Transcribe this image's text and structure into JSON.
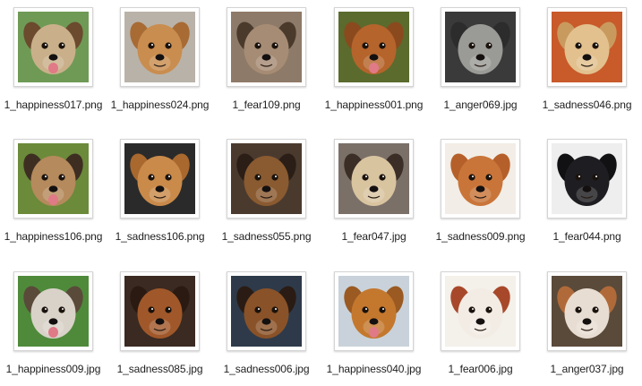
{
  "files": [
    {
      "name": "1_happiness017.png",
      "bg": "#6f9a55",
      "fur": "#c9b08a",
      "ear": "#6b4a2e",
      "tongue": true
    },
    {
      "name": "1_happiness024.png",
      "bg": "#b9b2a8",
      "fur": "#c98d4f",
      "ear": "#a86b34",
      "tongue": false
    },
    {
      "name": "1_fear109.png",
      "bg": "#8e7a68",
      "fur": "#a68c74",
      "ear": "#4a3a2c",
      "tongue": false
    },
    {
      "name": "1_happiness001.png",
      "bg": "#5a6b2d",
      "fur": "#b5642c",
      "ear": "#8a4a1e",
      "tongue": true
    },
    {
      "name": "1_anger069.jpg",
      "bg": "#3a3a3a",
      "fur": "#9a9a96",
      "ear": "#2c2c2c",
      "tongue": false
    },
    {
      "name": "1_sadness046.png",
      "bg": "#c95a2a",
      "fur": "#e2c18e",
      "ear": "#c99a5e",
      "tongue": false
    },
    {
      "name": "1_happiness106.png",
      "bg": "#6b8a3a",
      "fur": "#b58a5c",
      "ear": "#3e2e22",
      "tongue": true
    },
    {
      "name": "1_sadness106.png",
      "bg": "#2a2a2a",
      "fur": "#c98a4a",
      "ear": "#a8682e",
      "tongue": false
    },
    {
      "name": "1_sadness055.png",
      "bg": "#4a3a2e",
      "fur": "#8a5a30",
      "ear": "#2a1e16",
      "tongue": false
    },
    {
      "name": "1_fear047.jpg",
      "bg": "#7a7068",
      "fur": "#d9c4a0",
      "ear": "#3a2e26",
      "tongue": false
    },
    {
      "name": "1_sadness009.png",
      "bg": "#f2ede6",
      "fur": "#c9753a",
      "ear": "#b5602a",
      "tongue": false
    },
    {
      "name": "1_fear044.png",
      "bg": "#eeeeee",
      "fur": "#1e1e22",
      "ear": "#111114",
      "tongue": false
    },
    {
      "name": "1_happiness009.jpg",
      "bg": "#4f8a3a",
      "fur": "#d8d2c8",
      "ear": "#5a4a3a",
      "tongue": true
    },
    {
      "name": "1_sadness085.jpg",
      "bg": "#3a2a22",
      "fur": "#a0582a",
      "ear": "#2a1a12",
      "tongue": false
    },
    {
      "name": "1_sadness006.jpg",
      "bg": "#2e3a4a",
      "fur": "#8a5228",
      "ear": "#2a1c14",
      "tongue": false
    },
    {
      "name": "1_happiness040.jpg",
      "bg": "#c9d2da",
      "fur": "#c4782e",
      "ear": "#9a5a22",
      "tongue": true
    },
    {
      "name": "1_fear006.jpg",
      "bg": "#f4f0ea",
      "fur": "#f2ece4",
      "ear": "#a8482a",
      "tongue": false
    },
    {
      "name": "1_anger037.jpg",
      "bg": "#5a4a3a",
      "fur": "#e8ddd2",
      "ear": "#b06a3a",
      "tongue": false
    }
  ]
}
